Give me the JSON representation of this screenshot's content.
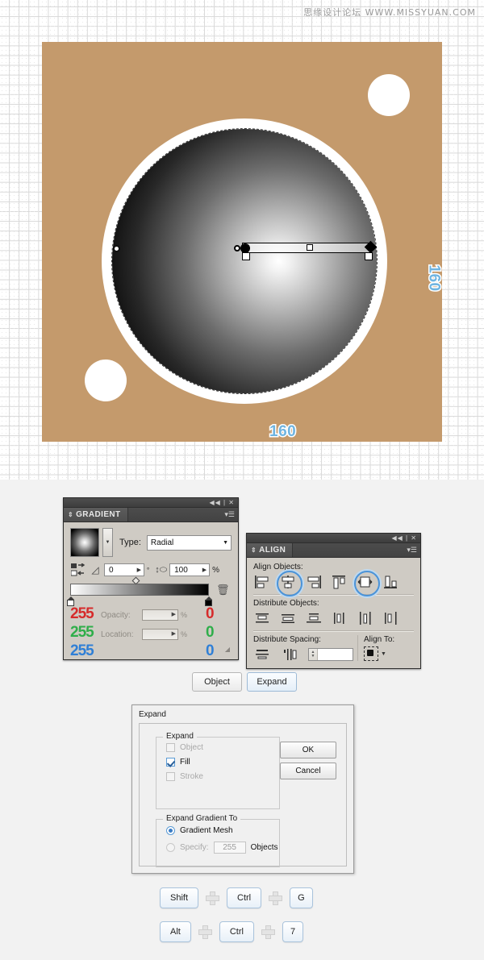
{
  "watermark": "思缘设计论坛 WWW.MISSYUAN.COM",
  "canvas": {
    "artboard_color": "#c49a6c",
    "dimension_bottom": "160",
    "dimension_right": "160",
    "dimension_color": "#6fb4e0"
  },
  "gradient_panel": {
    "tab_label": "GRADIENT",
    "type_label": "Type:",
    "type_value": "Radial",
    "angle_value": "0",
    "angle_unit": "°",
    "ratio_value": "100",
    "ratio_unit": "%",
    "opacity_label": "Opacity:",
    "opacity_value": "",
    "location_label": "Location:",
    "location_value": "",
    "percent_label": "%",
    "stop_left": {
      "r": "255",
      "g": "255",
      "b": "255",
      "color": "#ffffff"
    },
    "stop_right": {
      "r": "0",
      "g": "0",
      "b": "0",
      "color": "#000000"
    },
    "icons": {
      "collapse": "44",
      "close": "✕",
      "menu": "▾☰",
      "reverse": "reverse-gradient-icon",
      "trash": "🗑",
      "caret": "▼"
    }
  },
  "align_panel": {
    "tab_label": "ALIGN",
    "align_objects_label": "Align Objects:",
    "distribute_objects_label": "Distribute Objects:",
    "distribute_spacing_label": "Distribute Spacing:",
    "align_to_label": "Align To:",
    "spacing_value": "",
    "align_buttons": [
      "horizontal-align-left",
      "horizontal-align-center",
      "horizontal-align-right",
      "vertical-align-top",
      "vertical-align-center",
      "vertical-align-bottom"
    ],
    "align_highlighted": [
      1,
      4
    ],
    "distribute_buttons": [
      "vertical-distribute-top",
      "vertical-distribute-center",
      "vertical-distribute-bottom",
      "horizontal-distribute-left",
      "horizontal-distribute-center",
      "horizontal-distribute-right"
    ],
    "spacing_buttons": [
      "vertical-distribute-space",
      "horizontal-distribute-space"
    ]
  },
  "mid_buttons": {
    "object": "Object",
    "expand": "Expand"
  },
  "expand_dialog": {
    "title": "Expand",
    "group_expand_legend": "Expand",
    "checkbox_object": {
      "label": "Object",
      "checked": false,
      "disabled": true
    },
    "checkbox_fill": {
      "label": "Fill",
      "checked": true,
      "disabled": false
    },
    "checkbox_stroke": {
      "label": "Stroke",
      "checked": false,
      "disabled": true
    },
    "group_gradient_legend": "Expand Gradient To",
    "radio_mesh": {
      "label": "Gradient Mesh",
      "selected": true
    },
    "radio_specify": {
      "label": "Specify:",
      "selected": false
    },
    "specify_value": "255",
    "objects_label": "Objects",
    "ok_label": "OK",
    "cancel_label": "Cancel"
  },
  "shortcuts": [
    {
      "keys": [
        "Shift",
        "Ctrl",
        "G"
      ]
    },
    {
      "keys": [
        "Alt",
        "Ctrl",
        "7"
      ]
    }
  ]
}
